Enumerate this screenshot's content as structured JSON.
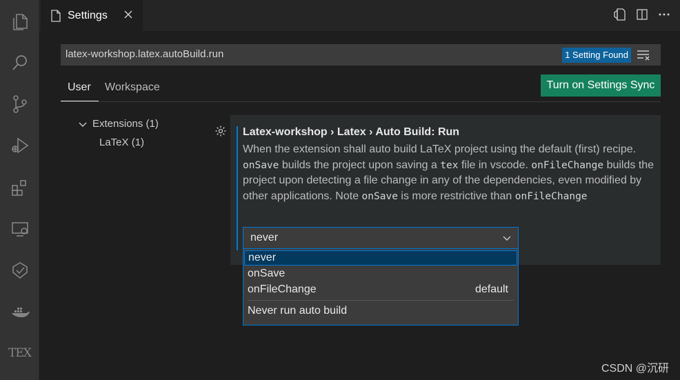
{
  "activity_bar": {
    "items": [
      {
        "name": "explorer",
        "icon": "files-icon"
      },
      {
        "name": "search",
        "icon": "search-icon"
      },
      {
        "name": "source-control",
        "icon": "source-control-icon"
      },
      {
        "name": "run-debug",
        "icon": "run-debug-icon"
      },
      {
        "name": "extensions",
        "icon": "extensions-icon"
      },
      {
        "name": "remote-explorer",
        "icon": "remote-explorer-icon"
      },
      {
        "name": "testing",
        "icon": "testing-icon"
      },
      {
        "name": "docker",
        "icon": "docker-icon"
      },
      {
        "name": "tex",
        "icon": "tex-icon",
        "label": "TEX"
      }
    ]
  },
  "tab": {
    "label": "Settings"
  },
  "search": {
    "value": "latex-workshop.latex.autoBuild.run",
    "result_badge": "1 Setting Found"
  },
  "scopes": {
    "user": "User",
    "workspace": "Workspace",
    "active": "User"
  },
  "sync_button": {
    "label": "Turn on Settings Sync"
  },
  "toc": {
    "group": "Extensions (1)",
    "item": "LaTeX (1)"
  },
  "setting": {
    "title": "Latex-workshop › Latex › Auto Build: Run",
    "desc": {
      "p1": "When the extension shall auto build LaTeX project using the default (first) recipe. ",
      "c1": "onSave",
      "p2": " builds the project upon saving a ",
      "c2": "tex",
      "p3": " file in vscode. ",
      "c3": "onFileChange",
      "p4": " builds the project upon detecting a file change in any of the dependencies, even modified by other applications. Note ",
      "c4": "onSave",
      "p5": " is more restrictive than ",
      "c5": "onFileChange"
    },
    "select_value": "never",
    "options": [
      {
        "label": "never",
        "selected": true
      },
      {
        "label": "onSave"
      },
      {
        "label": "onFileChange",
        "tag": "default"
      }
    ],
    "option_description": "Never run auto build"
  },
  "watermark": "CSDN @沉研",
  "colors": {
    "accent": "#0078d4",
    "sync_button": "#16825d",
    "badge": "#0e639c"
  }
}
